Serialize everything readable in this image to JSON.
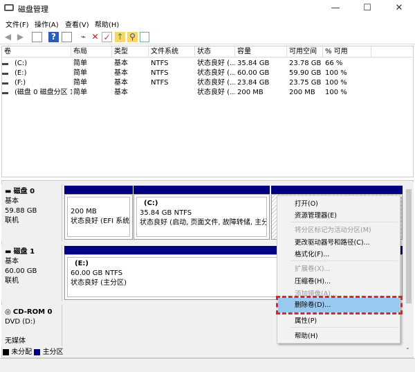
{
  "window": {
    "title": "磁盘管理",
    "min": "—",
    "max": "☐",
    "close": "✕"
  },
  "menu": [
    "文件(F)",
    "操作(A)",
    "查看(V)",
    "帮助(H)"
  ],
  "toolbar": [
    "back-icon",
    "forward-icon",
    "console-tree-icon",
    "help-icon",
    "action-pane-icon",
    "connect-icon",
    "delete-icon",
    "check-icon",
    "folder-up-icon",
    "search-folder-icon",
    "properties-icon"
  ],
  "list": {
    "headers": [
      "卷",
      "布局",
      "类型",
      "文件系统",
      "状态",
      "容量",
      "可用空间",
      "% 可用"
    ],
    "rows": [
      [
        "(C:)",
        "简单",
        "基本",
        "NTFS",
        "状态良好 (...",
        "35.84 GB",
        "23.78 GB",
        "66 %"
      ],
      [
        "(E:)",
        "简单",
        "基本",
        "NTFS",
        "状态良好 (...",
        "60.00 GB",
        "59.90 GB",
        "100 %"
      ],
      [
        "(F:)",
        "简单",
        "基本",
        "NTFS",
        "状态良好 (...",
        "23.84 GB",
        "23.75 GB",
        "100 %"
      ],
      [
        "(磁盘 0 磁盘分区 1)",
        "简单",
        "基本",
        "",
        "状态良好 (...",
        "200 MB",
        "200 MB",
        "100 %"
      ]
    ]
  },
  "disks": [
    {
      "name": "磁盘 0",
      "type": "基本",
      "size": "59.88 GB",
      "state": "联机",
      "parts": [
        {
          "label": "",
          "size": "200 MB",
          "status": "状态良好 (EFI 系统分"
        },
        {
          "label": "(C:)",
          "size": "35.84 GB NTFS",
          "status": "状态良好 (启动, 页面文件, 故障转储, 主分区)"
        }
      ]
    },
    {
      "name": "磁盘 1",
      "type": "基本",
      "size": "60.00 GB",
      "state": "联机",
      "parts": [
        {
          "label": "(E:)",
          "size": "60.00 GB NTFS",
          "status": "状态良好 (主分区)"
        }
      ]
    },
    {
      "name": "CD-ROM 0",
      "type": "DVD (D:)",
      "state": "无媒体"
    }
  ],
  "context_menu": [
    {
      "label": "打开(O)",
      "enabled": true
    },
    {
      "label": "资源管理器(E)",
      "enabled": true
    },
    {
      "label": "将分区标记为活动分区(M)",
      "enabled": false
    },
    {
      "label": "更改驱动器号和路径(C)...",
      "enabled": true
    },
    {
      "label": "格式化(F)...",
      "enabled": true
    },
    {
      "label": "扩展卷(X)...",
      "enabled": false
    },
    {
      "label": "压缩卷(H)...",
      "enabled": true
    },
    {
      "label": "添加镜像(A)...",
      "enabled": false
    },
    {
      "label": "删除卷(D)...",
      "enabled": true,
      "highlighted": true
    },
    {
      "label": "属性(P)",
      "enabled": true
    },
    {
      "label": "帮助(H)",
      "enabled": true
    }
  ],
  "legend": [
    {
      "label": "未分配",
      "color": "#000000"
    },
    {
      "label": "主分区",
      "color": "#000080"
    }
  ],
  "colors": {
    "primary_partition": "#000080",
    "highlight": "#99c9ef",
    "annotation": "#d9262c"
  }
}
